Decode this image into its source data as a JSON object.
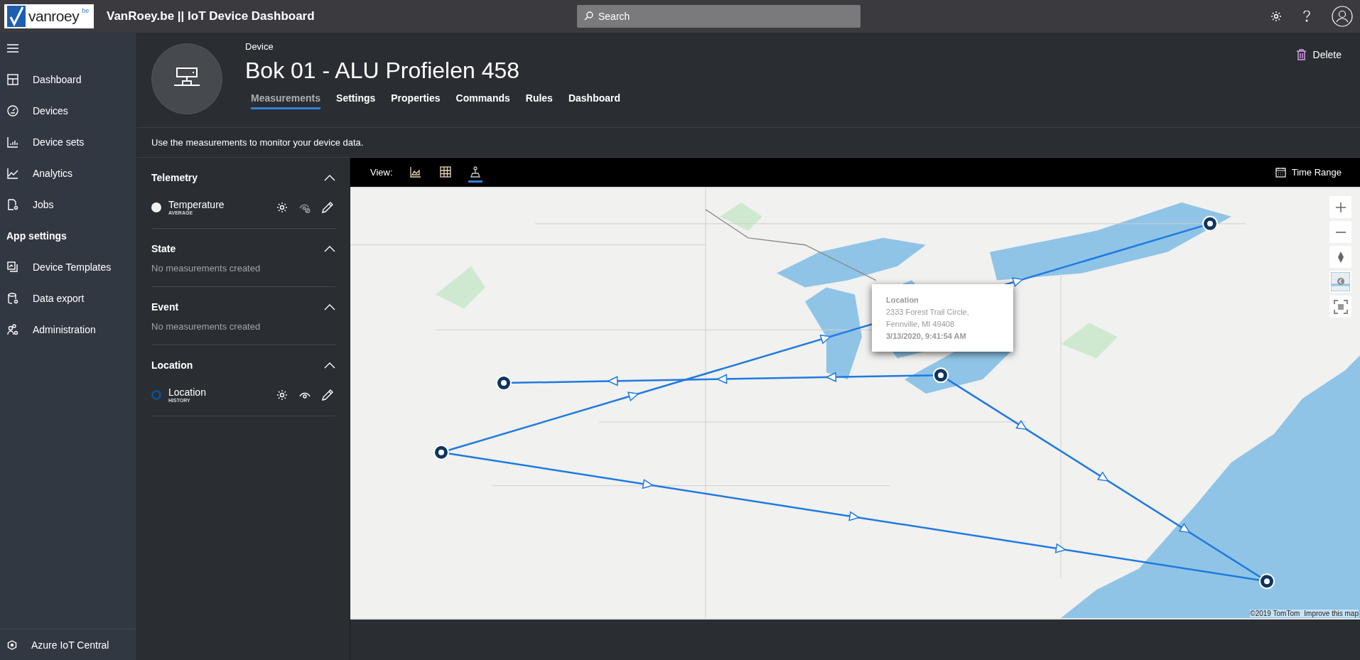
{
  "topbar": {
    "logo": {
      "name": "vanroey",
      "suffix": "be"
    },
    "title": "VanRoey.be || IoT Device Dashboard",
    "search": {
      "placeholder": "Search"
    }
  },
  "sidebar": {
    "items": [
      {
        "kind": "item",
        "label": "Dashboard"
      },
      {
        "kind": "item",
        "label": "Devices"
      },
      {
        "kind": "item",
        "label": "Device sets"
      },
      {
        "kind": "item",
        "label": "Analytics"
      },
      {
        "kind": "item",
        "label": "Jobs"
      },
      {
        "kind": "header",
        "label": "App settings"
      },
      {
        "kind": "item",
        "label": "Device Templates"
      },
      {
        "kind": "item",
        "label": "Data export"
      },
      {
        "kind": "item",
        "label": "Administration"
      }
    ],
    "footer": "Azure IoT Central"
  },
  "device": {
    "caption": "Device",
    "name": "Bok 01 - ALU Profielen 458",
    "delete": "Delete",
    "tabs": [
      {
        "label": "Measurements",
        "selected": true
      },
      {
        "label": "Settings",
        "selected": false
      },
      {
        "label": "Properties",
        "selected": false
      },
      {
        "label": "Commands",
        "selected": false
      },
      {
        "label": "Rules",
        "selected": false
      },
      {
        "label": "Dashboard",
        "selected": false
      }
    ],
    "description": "Use the measurements to monitor your device data."
  },
  "measurements": [
    {
      "title": "Telemetry",
      "expanded": true,
      "items": [
        {
          "name": "Temperature",
          "aggregation": "AVERAGE",
          "color": "#f2f2f2",
          "kind": "dot",
          "visible": false
        }
      ]
    },
    {
      "title": "State",
      "expanded": true,
      "empty": "No measurements created"
    },
    {
      "title": "Event",
      "expanded": true,
      "empty": "No measurements created"
    },
    {
      "title": "Location",
      "expanded": true,
      "items": [
        {
          "name": "Location",
          "aggregation": "HISTORY",
          "color": "#0f4f8a",
          "kind": "ring",
          "visible": true
        }
      ]
    }
  ],
  "view": {
    "label": "View:",
    "options": [
      {
        "kind": "chart",
        "selected": false
      },
      {
        "kind": "grid",
        "selected": false
      },
      {
        "kind": "map",
        "selected": true
      }
    ],
    "time_range": "Time Range"
  },
  "map": {
    "kind": "picture",
    "tooltip": {
      "title": "Location",
      "address_1": "2333 Forest Trail Circle,",
      "address_2": "Fennville, MI 49408",
      "time": "3/13/2020, 9:41:54 AM"
    },
    "copyright": "©2019 TomTom",
    "improve_link": "Improve this map"
  }
}
